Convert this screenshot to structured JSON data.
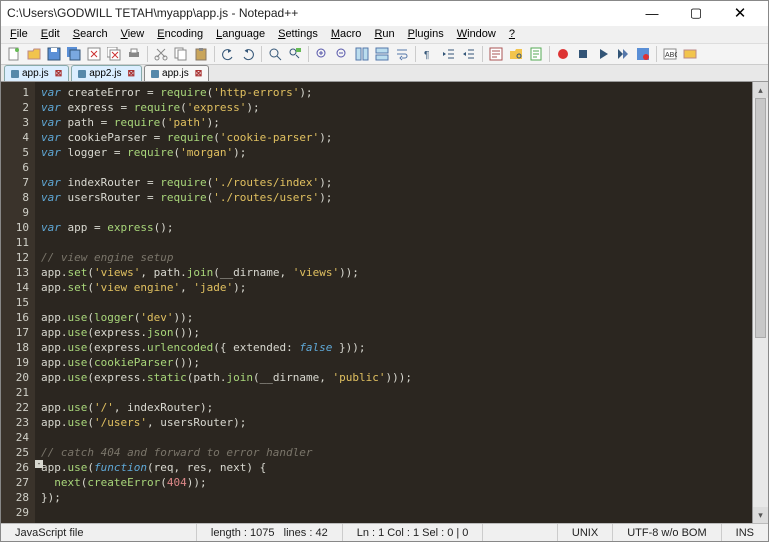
{
  "title": "C:\\Users\\GODWILL TETAH\\myapp\\app.js - Notepad++",
  "menu": [
    "File",
    "Edit",
    "Search",
    "View",
    "Encoding",
    "Language",
    "Settings",
    "Macro",
    "Run",
    "Plugins",
    "Window",
    "?"
  ],
  "tabs": [
    {
      "label": "app.js",
      "active": false
    },
    {
      "label": "app2.js",
      "active": false
    },
    {
      "label": "app.js",
      "active": true
    }
  ],
  "code": [
    [
      [
        "kw",
        "var"
      ],
      [
        "p",
        " "
      ],
      [
        "id",
        "createError"
      ],
      [
        "p",
        " = "
      ],
      [
        "fn",
        "require"
      ],
      [
        "p",
        "("
      ],
      [
        "str",
        "'http-errors'"
      ],
      [
        "p",
        ");"
      ]
    ],
    [
      [
        "kw",
        "var"
      ],
      [
        "p",
        " "
      ],
      [
        "id",
        "express"
      ],
      [
        "p",
        " = "
      ],
      [
        "fn",
        "require"
      ],
      [
        "p",
        "("
      ],
      [
        "str",
        "'express'"
      ],
      [
        "p",
        ");"
      ]
    ],
    [
      [
        "kw",
        "var"
      ],
      [
        "p",
        " "
      ],
      [
        "id",
        "path"
      ],
      [
        "p",
        " = "
      ],
      [
        "fn",
        "require"
      ],
      [
        "p",
        "("
      ],
      [
        "str",
        "'path'"
      ],
      [
        "p",
        ");"
      ]
    ],
    [
      [
        "kw",
        "var"
      ],
      [
        "p",
        " "
      ],
      [
        "id",
        "cookieParser"
      ],
      [
        "p",
        " = "
      ],
      [
        "fn",
        "require"
      ],
      [
        "p",
        "("
      ],
      [
        "str",
        "'cookie-parser'"
      ],
      [
        "p",
        ");"
      ]
    ],
    [
      [
        "kw",
        "var"
      ],
      [
        "p",
        " "
      ],
      [
        "id",
        "logger"
      ],
      [
        "p",
        " = "
      ],
      [
        "fn",
        "require"
      ],
      [
        "p",
        "("
      ],
      [
        "str",
        "'morgan'"
      ],
      [
        "p",
        ");"
      ]
    ],
    [],
    [
      [
        "kw",
        "var"
      ],
      [
        "p",
        " "
      ],
      [
        "id",
        "indexRouter"
      ],
      [
        "p",
        " = "
      ],
      [
        "fn",
        "require"
      ],
      [
        "p",
        "("
      ],
      [
        "str",
        "'./routes/index'"
      ],
      [
        "p",
        ");"
      ]
    ],
    [
      [
        "kw",
        "var"
      ],
      [
        "p",
        " "
      ],
      [
        "id",
        "usersRouter"
      ],
      [
        "p",
        " = "
      ],
      [
        "fn",
        "require"
      ],
      [
        "p",
        "("
      ],
      [
        "str",
        "'./routes/users'"
      ],
      [
        "p",
        ");"
      ]
    ],
    [],
    [
      [
        "kw",
        "var"
      ],
      [
        "p",
        " "
      ],
      [
        "id",
        "app"
      ],
      [
        "p",
        " = "
      ],
      [
        "fn",
        "express"
      ],
      [
        "p",
        "();"
      ]
    ],
    [],
    [
      [
        "cmt",
        "// view engine setup"
      ]
    ],
    [
      [
        "id",
        "app"
      ],
      [
        "p",
        "."
      ],
      [
        "fn",
        "set"
      ],
      [
        "p",
        "("
      ],
      [
        "str",
        "'views'"
      ],
      [
        "p",
        ", path."
      ],
      [
        "fn",
        "join"
      ],
      [
        "p",
        "(__dirname, "
      ],
      [
        "str",
        "'views'"
      ],
      [
        "p",
        "));"
      ]
    ],
    [
      [
        "id",
        "app"
      ],
      [
        "p",
        "."
      ],
      [
        "fn",
        "set"
      ],
      [
        "p",
        "("
      ],
      [
        "str",
        "'view engine'"
      ],
      [
        "p",
        ", "
      ],
      [
        "str",
        "'jade'"
      ],
      [
        "p",
        ");"
      ]
    ],
    [],
    [
      [
        "id",
        "app"
      ],
      [
        "p",
        "."
      ],
      [
        "fn",
        "use"
      ],
      [
        "p",
        "("
      ],
      [
        "fn",
        "logger"
      ],
      [
        "p",
        "("
      ],
      [
        "str",
        "'dev'"
      ],
      [
        "p",
        "));"
      ]
    ],
    [
      [
        "id",
        "app"
      ],
      [
        "p",
        "."
      ],
      [
        "fn",
        "use"
      ],
      [
        "p",
        "(express."
      ],
      [
        "fn",
        "json"
      ],
      [
        "p",
        "());"
      ]
    ],
    [
      [
        "id",
        "app"
      ],
      [
        "p",
        "."
      ],
      [
        "fn",
        "use"
      ],
      [
        "p",
        "(express."
      ],
      [
        "fn",
        "urlencoded"
      ],
      [
        "p",
        "({ extended: "
      ],
      [
        "kw",
        "false"
      ],
      [
        "p",
        " }));"
      ]
    ],
    [
      [
        "id",
        "app"
      ],
      [
        "p",
        "."
      ],
      [
        "fn",
        "use"
      ],
      [
        "p",
        "("
      ],
      [
        "fn",
        "cookieParser"
      ],
      [
        "p",
        "());"
      ]
    ],
    [
      [
        "id",
        "app"
      ],
      [
        "p",
        "."
      ],
      [
        "fn",
        "use"
      ],
      [
        "p",
        "(express."
      ],
      [
        "fn",
        "static"
      ],
      [
        "p",
        "(path."
      ],
      [
        "fn",
        "join"
      ],
      [
        "p",
        "(__dirname, "
      ],
      [
        "str",
        "'public'"
      ],
      [
        "p",
        ")));"
      ]
    ],
    [],
    [
      [
        "id",
        "app"
      ],
      [
        "p",
        "."
      ],
      [
        "fn",
        "use"
      ],
      [
        "p",
        "("
      ],
      [
        "str",
        "'/'"
      ],
      [
        "p",
        ", indexRouter);"
      ]
    ],
    [
      [
        "id",
        "app"
      ],
      [
        "p",
        "."
      ],
      [
        "fn",
        "use"
      ],
      [
        "p",
        "("
      ],
      [
        "str",
        "'/users'"
      ],
      [
        "p",
        ", usersRouter);"
      ]
    ],
    [],
    [
      [
        "cmt",
        "// catch 404 and forward to error handler"
      ]
    ],
    [
      [
        "id",
        "app"
      ],
      [
        "p",
        "."
      ],
      [
        "fn",
        "use"
      ],
      [
        "p",
        "("
      ],
      [
        "kw",
        "function"
      ],
      [
        "p",
        "(req, res, next) {"
      ]
    ],
    [
      [
        "p",
        "  "
      ],
      [
        "fn",
        "next"
      ],
      [
        "p",
        "("
      ],
      [
        "fn",
        "createError"
      ],
      [
        "p",
        "("
      ],
      [
        "num",
        "404"
      ],
      [
        "p",
        "));"
      ]
    ],
    [
      [
        "p",
        "});"
      ]
    ],
    []
  ],
  "status": {
    "lang": "JavaScript file",
    "length": "length : 1075",
    "lines": "lines : 42",
    "pos": "Ln : 1   Col : 1   Sel : 0 | 0",
    "eol": "UNIX",
    "enc": "UTF-8 w/o BOM",
    "mode": "INS"
  }
}
